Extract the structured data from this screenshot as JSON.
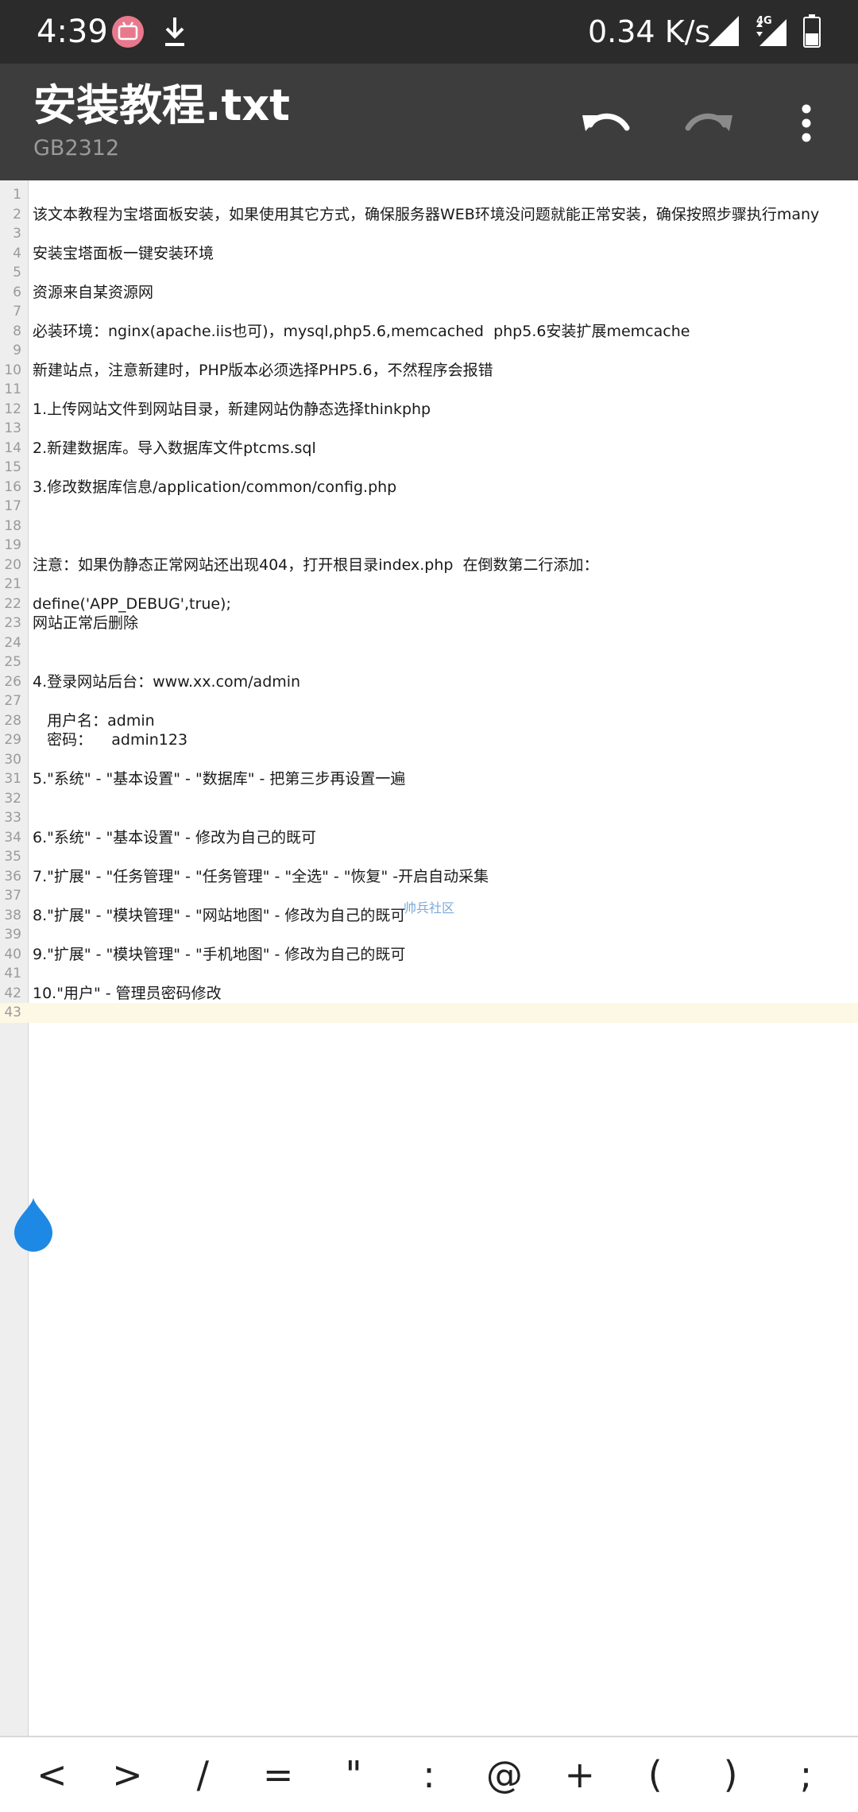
{
  "status_bar": {
    "time": "4:39",
    "app_icon_text": "bilibili",
    "network_speed": "0.34 K/s",
    "network_type": "4G",
    "icons": [
      "bilibili-icon",
      "download-icon",
      "signal-icon",
      "signal-4g-icon",
      "battery-icon"
    ]
  },
  "app_bar": {
    "title": "安装教程.txt",
    "encoding": "GB2312",
    "background": "#3d3d3d"
  },
  "editor": {
    "current_line": 43,
    "watermark": "帅兵社区",
    "lines": [
      "",
      "该文本教程为宝塔面板安装，如果使用其它方式，确保服务器WEB环境没问题就能正常安装，确保按照步骤执行many",
      "",
      "安装宝塔面板一键安装环境",
      "",
      "资源来自某资源网",
      "",
      "必装环境：nginx(apache.iis也可)，mysql,php5.6,memcached  php5.6安装扩展memcache",
      "",
      "新建站点，注意新建时，PHP版本必须选择PHP5.6，不然程序会报错",
      "",
      "1.上传网站文件到网站目录，新建网站伪静态选择thinkphp",
      "",
      "2.新建数据库。导入数据库文件ptcms.sql",
      "",
      "3.修改数据库信息/application/common/config.php",
      "",
      "",
      "",
      "注意：如果伪静态正常网站还出现404，打开根目录index.php  在倒数第二行添加：",
      "",
      "define('APP_DEBUG',true);",
      "网站正常后删除",
      "",
      "",
      "4.登录网站后台：www.xx.com/admin",
      "",
      "   用户名：admin",
      "   密码：    admin123",
      "",
      "5.\"系统\" - \"基本设置\" - \"数据库\" - 把第三步再设置一遍",
      "",
      "",
      "6.\"系统\" - \"基本设置\" - 修改为自己的既可",
      "",
      "7.\"扩展\" - \"任务管理\" - \"任务管理\" - \"全选\" - \"恢复\" -开启自动采集",
      "",
      "8.\"扩展\" - \"模块管理\" - \"网站地图\" - 修改为自己的既可",
      "",
      "9.\"扩展\" - \"模块管理\" - \"手机地图\" - 修改为自己的既可",
      "",
      "10.\"用户\" - 管理员密码修改",
      ""
    ]
  },
  "symbol_bar": {
    "keys": [
      "<",
      ">",
      "/",
      "=",
      "\"",
      ":",
      "@",
      "+",
      "(",
      ")",
      ";"
    ]
  },
  "colors": {
    "accent": "#1e88e5",
    "current_line": "#fdf8e4"
  }
}
